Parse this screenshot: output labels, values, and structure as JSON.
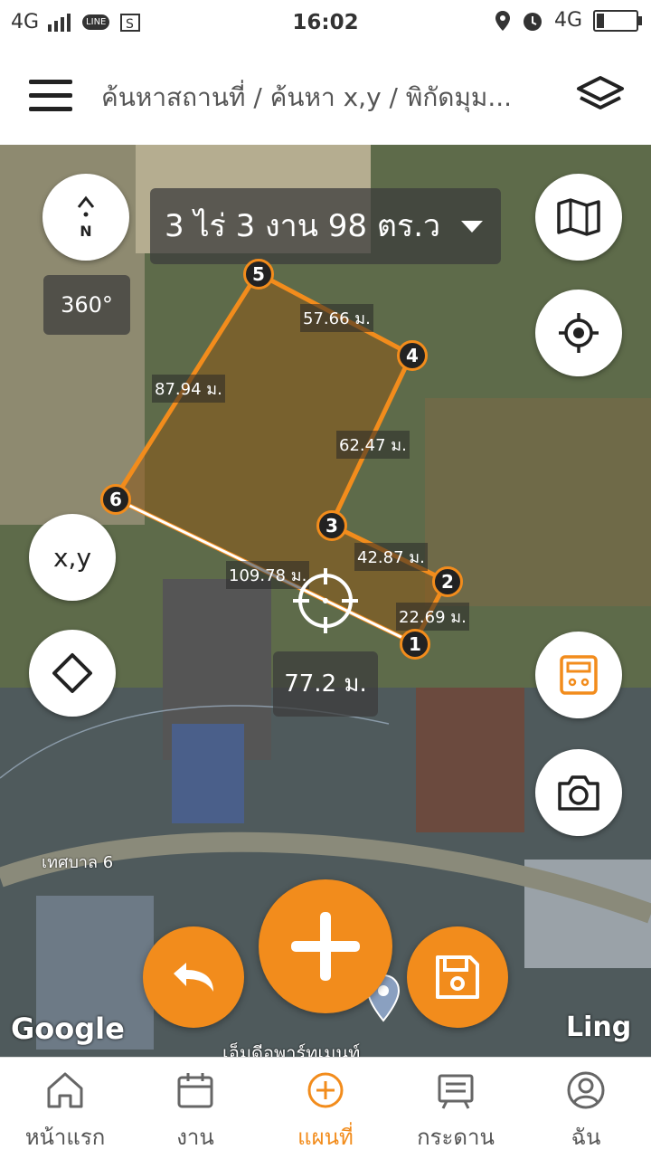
{
  "status_bar": {
    "network_left": "4G",
    "line_badge": "LINE",
    "time": "16:02",
    "network_right": "4G",
    "battery_percent": 15
  },
  "app_bar": {
    "breadcrumb": "ค้นหาสถานที่ / ค้นหา x,y / พิกัดมุม...",
    "menu_icon": "hamburger-icon",
    "layers_icon": "layers-icon"
  },
  "map": {
    "compass_label": "N",
    "area": "3 ไร่ 3 งาน 98 ตร.ว",
    "view_360": "360°",
    "xy_button": "x,y",
    "distance_readout": "77.2 ม.",
    "measurements": {
      "edge_5_4": "57.66 ม.",
      "edge_6_5": "87.94 ม.",
      "edge_4_3": "62.47 ม.",
      "edge_3_2": "42.87 ม.",
      "edge_6_1": "109.78 ม.",
      "edge_2_1": "22.69 ม."
    },
    "vertices": [
      "1",
      "2",
      "3",
      "4",
      "5",
      "6"
    ],
    "road_label": "เทศบาล 6",
    "poi_label": "เอ็มดีอพาร์ทเมนท์",
    "google_logo": "Google",
    "ling_logo": "Ling"
  },
  "bottom_nav": {
    "items": [
      {
        "label": "หน้าแรก",
        "icon": "home-icon",
        "active": false
      },
      {
        "label": "งาน",
        "icon": "calendar-icon",
        "active": false
      },
      {
        "label": "แผนที่",
        "icon": "add-circle-icon",
        "active": true
      },
      {
        "label": "กระดาน",
        "icon": "board-icon",
        "active": false
      },
      {
        "label": "ฉัน",
        "icon": "profile-icon",
        "active": false
      }
    ]
  },
  "colors": {
    "accent": "#f28c1c",
    "plot_fill": "#8a5a1c",
    "text_dark": "#222222"
  }
}
